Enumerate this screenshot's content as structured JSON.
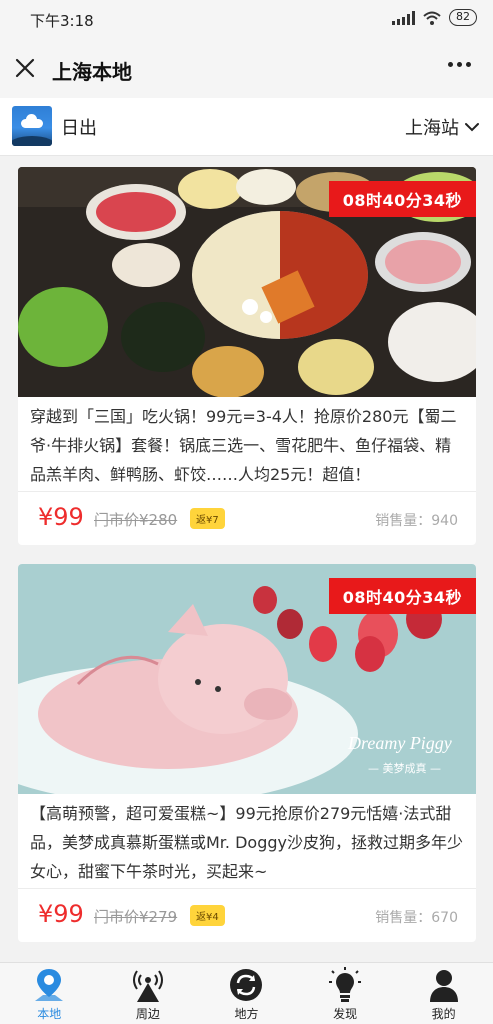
{
  "status_bar": {
    "time": "下午3:18",
    "battery": "82"
  },
  "nav": {
    "title": "上海本地"
  },
  "location": {
    "weather": "日出",
    "station": "上海站"
  },
  "cards": [
    {
      "timer": "08时40分34秒",
      "description": "穿越到「三国」吃火锅！99元=3-4人！抢原价280元【蜀二爷·牛排火锅】套餐！锅底三选一、雪花肥牛、鱼仔福袋、精品羔羊肉、鲜鸭肠、虾饺……人均25元！超值！",
      "price": "¥99",
      "original_price": "门市价¥280",
      "rebate": "返¥7",
      "sales": "销售量：940"
    },
    {
      "timer": "08时40分34秒",
      "description": "【高萌预警，超可爱蛋糕~】99元抢原价279元恬嬉·法式甜品，美梦成真慕斯蛋糕或Mr. Doggy沙皮狗，拯救过期多年少女心，甜蜜下午茶时光，买起来~",
      "price": "¥99",
      "original_price": "门市价¥279",
      "rebate": "返¥4",
      "sales": "销售量：670",
      "image_text": {
        "title": "Dreamy Piggy",
        "subtitle": "— 美梦成真 —"
      }
    }
  ],
  "tabs": [
    {
      "label": "本地",
      "icon": "location-pin-icon",
      "active": true
    },
    {
      "label": "周边",
      "icon": "broadcast-tower-icon",
      "active": false
    },
    {
      "label": "地方",
      "icon": "refresh-circle-icon",
      "active": false
    },
    {
      "label": "发现",
      "icon": "lightbulb-icon",
      "active": false
    },
    {
      "label": "我的",
      "icon": "person-icon",
      "active": false
    }
  ],
  "colors": {
    "accent": "#2a8be0",
    "timer_bg": "#e8191a",
    "price": "#ee2d2d",
    "rebate_bg": "#ffd43b"
  }
}
